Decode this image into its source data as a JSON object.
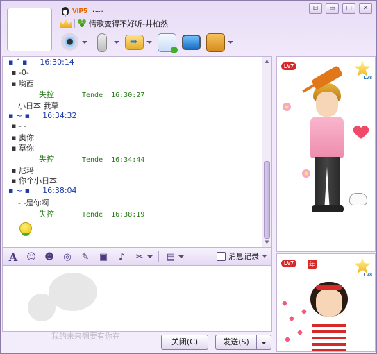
{
  "header": {
    "vip_label": "VIP5",
    "nickname": "·~·",
    "signature": "情歌变得不好听-井柏然"
  },
  "window_controls": [
    "⊟",
    "▭",
    "▢",
    "✕"
  ],
  "chat": {
    "messages": [
      {
        "kind": "self",
        "name": "▪ ˇ ▪",
        "time": "16:30:14"
      },
      {
        "kind": "text",
        "text": "▪ -0-"
      },
      {
        "kind": "text",
        "text": "▪ 哟西"
      },
      {
        "kind": "other",
        "name": "失控",
        "device": "Tende",
        "time": "16:30:27"
      },
      {
        "kind": "text",
        "text": "小日本  我草"
      },
      {
        "kind": "self",
        "name": "▪ ~ ▪",
        "time": "16:34:32"
      },
      {
        "kind": "text",
        "text": "▪ - -"
      },
      {
        "kind": "text",
        "text": "▪ 奥你"
      },
      {
        "kind": "text",
        "text": "▪ 草你"
      },
      {
        "kind": "other",
        "name": "失控",
        "device": "Tende",
        "time": "16:34:44"
      },
      {
        "kind": "text",
        "text": "▪ 尼玛"
      },
      {
        "kind": "text",
        "text": "▪ 你个小日本"
      },
      {
        "kind": "self",
        "name": "▪ ~ ▪",
        "time": "16:38:04"
      },
      {
        "kind": "text",
        "text": "- -是你啊"
      },
      {
        "kind": "other",
        "name": "失控",
        "device": "Tende",
        "time": "16:38:19"
      }
    ]
  },
  "input_toolbar": {
    "history_label": "消息记录"
  },
  "input": {
    "watermark_text": "我的未来想要有你在"
  },
  "buttons": {
    "close_label": "关闭(C)",
    "send_label": "发送(S)"
  },
  "show_panel": {
    "top_level": "LV7",
    "top_star": "LV8",
    "bottom_level": "LV7",
    "bottom_year": "年",
    "bottom_star": "LV8"
  },
  "colors": {
    "accent": "#e8dcf6",
    "self_name": "#1a3aa8",
    "other_name": "#2a7a1a"
  }
}
